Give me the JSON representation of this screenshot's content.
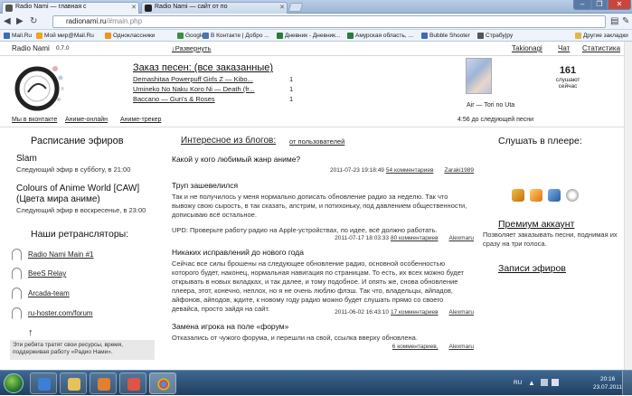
{
  "browser": {
    "tabs": [
      {
        "title": "Radio Nami — главная с"
      },
      {
        "title": "Radio Nami — сайт от по"
      }
    ],
    "url_host": "radionami.ru",
    "url_path": "/#main.php",
    "bookmarks": [
      "Mail.Ru",
      "Мой мир@Mail.Ru",
      "Одноклассники",
      "Google",
      "В Контакте | Добро ...",
      "Дневник - Дневник...",
      "Амурская область, ...",
      "Bubble Shooter",
      "Страбу|ру"
    ],
    "other_bookmarks": "Другие закладки"
  },
  "site": {
    "name": "Radio Nami",
    "version": "0.7.0",
    "expand": "↓Развернуть",
    "nav": [
      "Takionagi",
      "Чат",
      "Статистика"
    ],
    "order": {
      "title": "Заказ песен: (все заказанные)",
      "items": [
        {
          "song": "Demashitaa Powerpuff Girls Z — Kibo...",
          "count": "1"
        },
        {
          "song": "Umineko No Naku Koro Ni — Death (fr...",
          "count": "1"
        },
        {
          "song": "Baccano — Gun's & Roses",
          "count": "1"
        }
      ]
    },
    "now_playing": "Air — Tori no Uta",
    "listeners": {
      "count": "161",
      "label1": "слушают",
      "label2": "сейчас"
    },
    "time_left": "4:56 до следующей песни",
    "links": [
      "Мы в вконтакте",
      "Аниме-онлайн",
      "Аниме-трекер"
    ]
  },
  "schedule": {
    "title": "Расписание эфиров",
    "items": [
      {
        "name": "Slam",
        "when": "Следующий эфир в субботу, в 21:00"
      },
      {
        "name": "Colours of Anime World [CAW]",
        "name2": "(Цвета мира аниме)",
        "when": "Следующий эфир в воскресенье, в 23:00"
      }
    ]
  },
  "relays": {
    "title": "Наши ретрансляторы:",
    "items": [
      "Radio Nami Main #1",
      "BeeS Relay",
      "Arcada-team",
      "ru-hoster.com/forum"
    ],
    "note": "Эти ребята тратят свои ресурсы, время, поддерживая работу «Радио Нами»."
  },
  "blogs": {
    "title": "Интересное из блогов:",
    "filter": "от пользователей",
    "posts": [
      {
        "title": "Какой у кого любимый жанр аниме?",
        "body": "",
        "date": "2011-07-23 19:18:49",
        "comments": "54 комментариев",
        "author": "Zaraki1989"
      },
      {
        "title": "Труп зашевелился",
        "body": "Так и не получилось у меня нормально дописать обновление радио за неделю. Так что вывожу свою сырость, в так сказать, апстрим, и потихоньку, под давлением общественности, дописываю всё остальное.",
        "extra": "UPD: Проверьте работу радио на Apple-устройствах, по идее, всё должно работать.",
        "date": "2011-07-17 18:03:33",
        "comments": "80 комментариев",
        "author": "Alexmaru"
      },
      {
        "title": "Никаких исправлений до нового года",
        "body": "Сейчас все силы брошены на следующее обновление радио, основной особенностью которого будет, наконец, нормальная навигация по страницам. То есть, их всех можно будет открывать в новых вкладках, и так далее, и тому подобное. И опять же, снова обновление плеера, этот, конечно, неплох, но я не очень люблю флэш. Так что, владельцы, айпадов, айфонов, айподов, ждите, к новому году радио можно будет слушать прямо со своего девайса, просто зайдя на сайт.",
        "date": "2011-06-02 16:43:10",
        "comments": "17 комментариев",
        "author": "Alexmaru"
      },
      {
        "title": "Замена игрока на поле «форум»",
        "body": "Отказались от чужого форума, и перешли на свой, ссылка вверху обновлена.",
        "date": "",
        "comments": "6 комментариев,",
        "author": "Alexmaru"
      }
    ]
  },
  "right": {
    "player_title": "Слушать в плеере:",
    "premium_title": "Премиум аккаунт",
    "premium_text": "Позволяет заказывать песни, поднимая их сразу на три голоса.",
    "records_title": "Записи эфиров"
  },
  "taskbar": {
    "lang": "RU",
    "time": "20:16",
    "date": "23.07.2011"
  }
}
